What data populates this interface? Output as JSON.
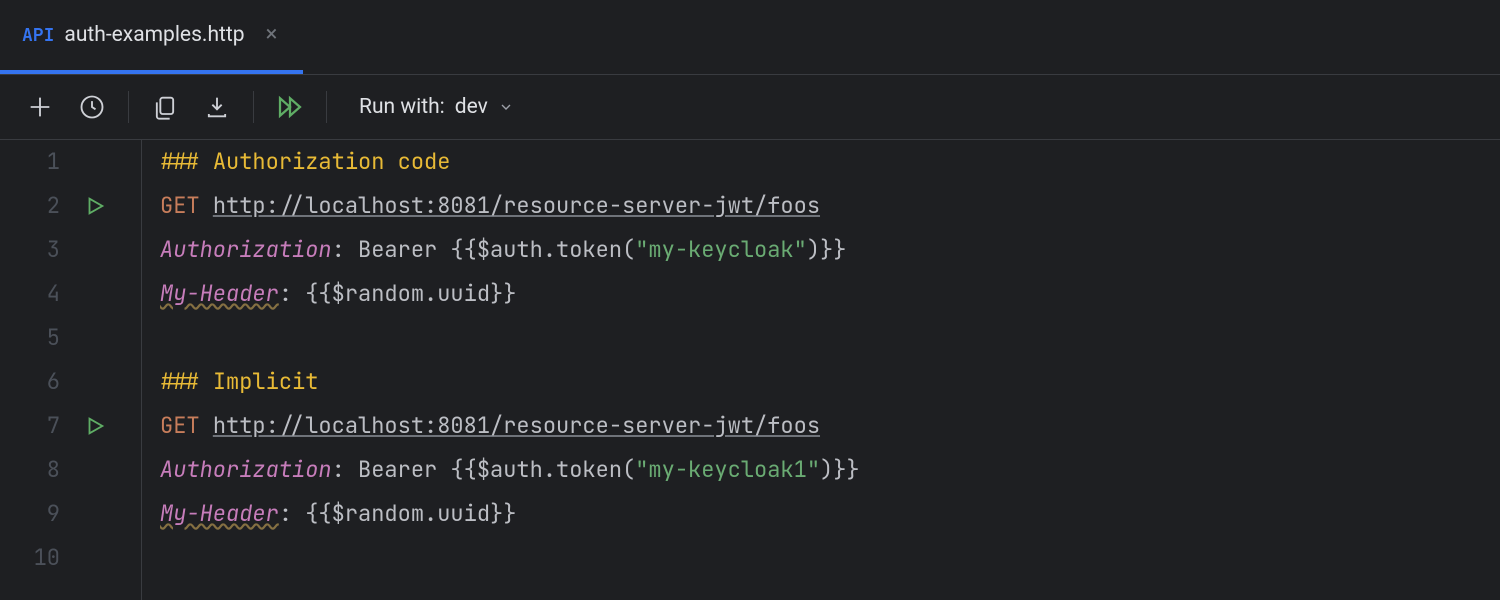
{
  "tab": {
    "badge": "API",
    "filename": "auth-examples.http"
  },
  "toolbar": {
    "run_with_label": "Run with:",
    "environment": "dev"
  },
  "lines": {
    "l1_marker": "### ",
    "l1_title": "Authorization code",
    "l2_method": "GET ",
    "l2_url": "http://localhost:8081/resource-server-jwt/foos",
    "l3_hdr": "Authorization",
    "l3_val_pre": "Bearer {{$auth.token(",
    "l3_val_str": "\"my-keycloak\"",
    "l3_val_post": ")}}",
    "l4_hdr": "My-Header",
    "l4_val": "{{$random.uuid}}",
    "l6_marker": "### ",
    "l6_title": "Implicit",
    "l7_method": "GET ",
    "l7_url": "http://localhost:8081/resource-server-jwt/foos",
    "l8_hdr": "Authorization",
    "l8_val_pre": "Bearer {{$auth.token(",
    "l8_val_str": "\"my-keycloak1\"",
    "l8_val_post": ")}}",
    "l9_hdr": "My-Header",
    "l9_val": "{{$random.uuid}}"
  },
  "lineNumbers": {
    "n1": "1",
    "n2": "2",
    "n3": "3",
    "n4": "4",
    "n5": "5",
    "n6": "6",
    "n7": "7",
    "n8": "8",
    "n9": "9",
    "n10": "10"
  },
  "colon": ": "
}
